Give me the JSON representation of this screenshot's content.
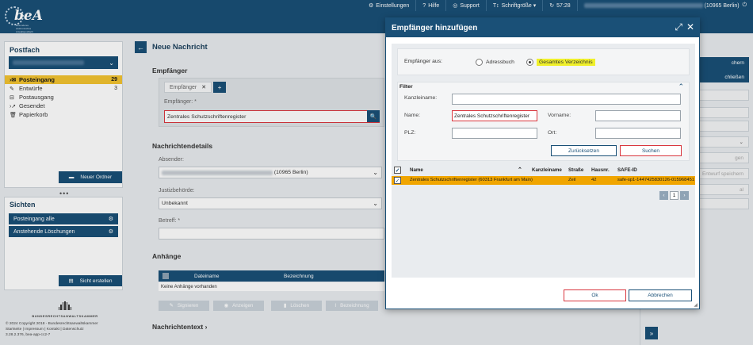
{
  "app": {
    "logo_text": "beA",
    "logo_sub": "Besonderes elektronisches Anwaltspostfach"
  },
  "topnav": {
    "settings": "Einstellungen",
    "help": "Hilfe",
    "support": "Support",
    "font_size": "Schriftgröße",
    "timer": "57:28",
    "user_location": "(10965 Berlin)"
  },
  "sidebar": {
    "title": "Postfach",
    "items": [
      {
        "label": "Posteingang",
        "count": "29"
      },
      {
        "label": "Entwürfe",
        "count": "3"
      },
      {
        "label": "Postausgang",
        "count": ""
      },
      {
        "label": "Gesendet",
        "count": ""
      },
      {
        "label": "Papierkorb",
        "count": ""
      }
    ],
    "new_folder": "Neuer Ordner"
  },
  "sichten": {
    "title": "Sichten",
    "items": [
      "Posteingang alle",
      "Anstehende Löschungen"
    ],
    "create": "Sicht erstellen"
  },
  "footer": {
    "org": "BUNDESRECHTSANWALTSKAMMER",
    "copyright": "© 2024 Copyright 2018 - Bundesrechtsanwaltskammer",
    "links": "Startseite | Impressum | Kontakt | Datenschutz",
    "version": "3.28.2.376, bea-app-cc2-7"
  },
  "main": {
    "title": "Neue Nachricht",
    "recipients_section": "Empfänger",
    "tab_label": "Empfänger",
    "recipient_label": "Empfänger: *",
    "recipient_value": "Zentrales Schutzschriftenregister",
    "details_section": "Nachrichtendetails",
    "sender_label": "Absender:",
    "sender_suffix": "(10965 Berlin)",
    "court_label": "Justizbehörde:",
    "court_value": "Unbekannt",
    "subject_label": "Betreff: *",
    "attachments_section": "Anhänge",
    "att_col1": "Dateiname",
    "att_col2": "Bezeichnung",
    "att_empty": "Keine Anhänge vorhanden",
    "att_buttons": [
      "Signieren",
      "Anzeigen",
      "Löschen",
      "Bezeichnung"
    ],
    "message_text": "Nachrichtentext"
  },
  "right_panel": {
    "buttons": [
      "chern",
      "chließen"
    ],
    "boxes": [
      "gen",
      "Entwurf speichern",
      "al"
    ]
  },
  "modal": {
    "title": "Empfänger hinzufügen",
    "recipients_from": "Empfänger aus:",
    "opt_address": "Adressbuch",
    "opt_directory": "Gesamtes Verzeichnis",
    "filter": "Filter",
    "firm_label": "Kanzleiname:",
    "name_label": "Name:",
    "name_value": "Zentrales Schutzschriftenregister",
    "first_label": "Vorname:",
    "zip_label": "PLZ:",
    "city_label": "Ort:",
    "reset": "Zurücksetzen",
    "search": "Suchen",
    "columns": [
      "Name",
      "Kanzleiname",
      "Straße",
      "Hausnr.",
      "SAFE-ID"
    ],
    "result": {
      "name": "Zentrales Schutzschriftenregister (60313 Frankfurt am Main)",
      "firm": "",
      "street": "Zeil",
      "number": "42",
      "safe_id": "safe-sp1-1447425830126-015968451"
    },
    "page": "1",
    "ok": "Ok",
    "cancel": "Abbrechen"
  }
}
